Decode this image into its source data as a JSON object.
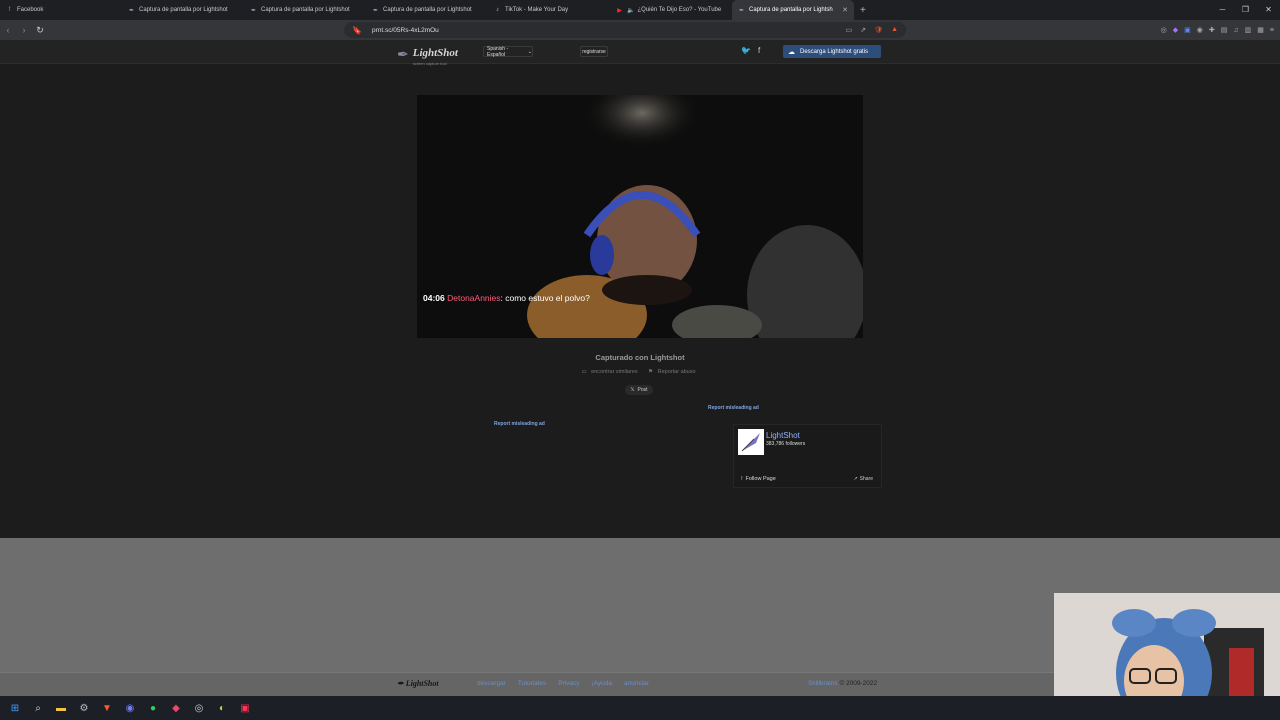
{
  "browser": {
    "tabs": [
      {
        "title": "Facebook",
        "icon": "facebook-icon",
        "active": false
      },
      {
        "title": "Captura de pantalla por Lightshot",
        "icon": "feather-icon",
        "active": false
      },
      {
        "title": "Captura de pantalla por Lightshot",
        "icon": "feather-icon",
        "active": false
      },
      {
        "title": "Captura de pantalla por Lightshot",
        "icon": "feather-icon",
        "active": false
      },
      {
        "title": "TikTok - Make Your Day",
        "icon": "tiktok-icon",
        "active": false
      },
      {
        "title": "¿Quién Te Dijo Eso? - YouTube",
        "icon": "youtube-icon",
        "active": false
      },
      {
        "title": "Captura de pantalla por Lightsh",
        "icon": "feather-icon",
        "active": true
      }
    ],
    "url": "prnt.sc/05Rs-4xL2mOu"
  },
  "lightshot": {
    "logo_name": "LightShot",
    "logo_sub": "screen capture tool",
    "language": "Spanish - Español",
    "register": "registrarse",
    "download": "Descarga Lightshot gratis",
    "caption_time": "04:06",
    "caption_user": "DetonaAnnies",
    "caption_text": ": como estuvo el polvo?",
    "captured": "Capturado con Lightshot",
    "find_similar": "encontrar similares",
    "report_abuse": "Reportar abuso",
    "x_post": "Post",
    "report_ad_1": "Report misleading ad",
    "report_ad_2": "Report misleading ad"
  },
  "facebook_widget": {
    "name": "LightShot",
    "followers": "383,786 followers",
    "follow": "Follow Page",
    "share": "Share"
  },
  "footer": {
    "logo": "LightShot",
    "links": [
      "descargar",
      "Tutoriales",
      "Privacy",
      "¡Ayuda",
      "anunciar"
    ],
    "brand": "Skillbrains",
    "copyright": "© 2009-2022"
  },
  "colors": {
    "page_bg": "#1c1c1c",
    "accent_blue": "#2d4d7a",
    "link_blue": "#7fa6e0",
    "caption_user": "#ff5c7a"
  }
}
